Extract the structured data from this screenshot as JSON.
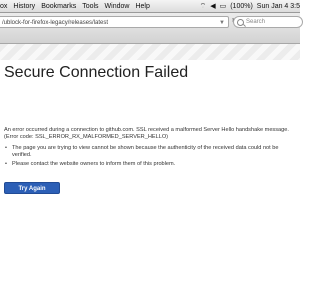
{
  "menubar": {
    "items": [
      "ox",
      "History",
      "Bookmarks",
      "Tools",
      "Window",
      "Help"
    ],
    "battery": "(100%)",
    "clock": "Sun Jan 4 3:5"
  },
  "toolbar": {
    "url": "/ublock-for-firefox-legacy/releases/latest",
    "search_placeholder": "Search"
  },
  "error": {
    "title": "Secure Connection Failed",
    "description": "An error occurred during a connection to github.com. SSL received a malformed Server Hello handshake message. (Error code: SSL_ERROR_RX_MALFORMED_SERVER_HELLO)",
    "bullets": [
      "The page you are trying to view cannot be shown because the authenticity of the received data could not be verified.",
      "Please contact the website owners to inform them of this problem."
    ],
    "button_label": "Try Again"
  },
  "colors": {
    "accent": "#2c5fb6"
  }
}
